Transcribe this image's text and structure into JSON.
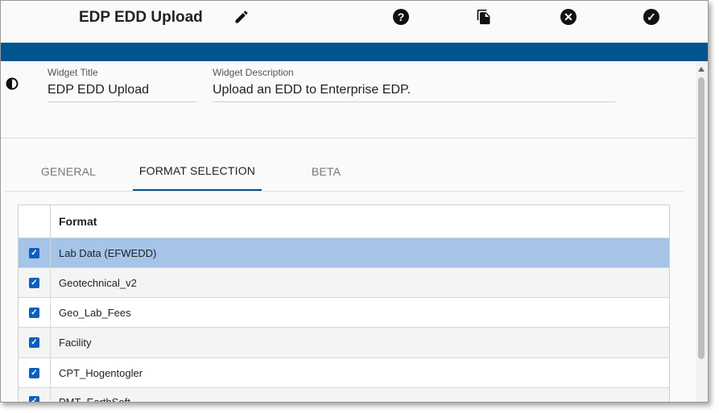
{
  "header": {
    "title": "EDP EDD Upload"
  },
  "icons": {
    "edit": "pencil-icon",
    "help": "help-icon",
    "copy": "copy-icon",
    "close": "close-icon",
    "confirm": "check-icon",
    "contrast": "contrast-icon"
  },
  "colors": {
    "accent": "#00548f",
    "selected_row": "#a5c4e8",
    "checkbox": "#0b5fbf"
  },
  "fields": {
    "title_label": "Widget Title",
    "title_value": "EDP EDD Upload",
    "description_label": "Widget Description",
    "description_value": "Upload an EDD to Enterprise EDP."
  },
  "tabs": [
    {
      "label": "GENERAL",
      "active": false
    },
    {
      "label": "FORMAT SELECTION",
      "active": true
    },
    {
      "label": "BETA",
      "active": false
    }
  ],
  "table": {
    "header": "Format",
    "rows": [
      {
        "label": "Lab Data (EFWEDD)",
        "checked": true,
        "selected": true
      },
      {
        "label": "Geotechnical_v2",
        "checked": true,
        "selected": false
      },
      {
        "label": "Geo_Lab_Fees",
        "checked": true,
        "selected": false
      },
      {
        "label": "Facility",
        "checked": true,
        "selected": false
      },
      {
        "label": "CPT_Hogentogler",
        "checked": true,
        "selected": false
      },
      {
        "label": "PMT_EarthSoft",
        "checked": true,
        "selected": false
      }
    ]
  }
}
